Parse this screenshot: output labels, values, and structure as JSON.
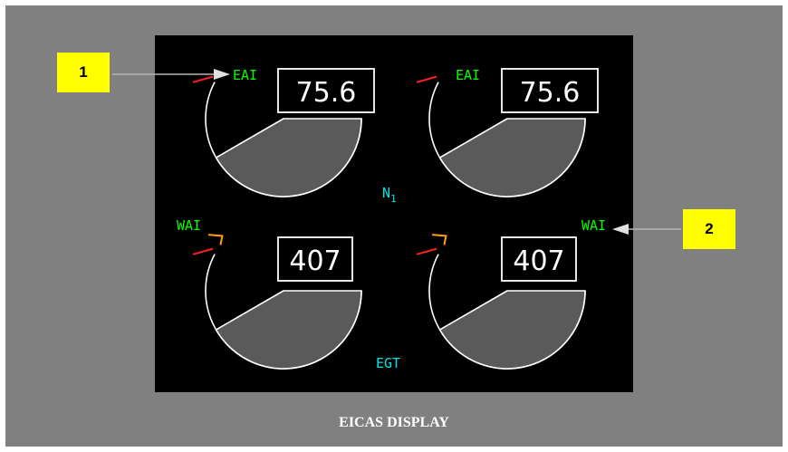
{
  "title": "EICAS DISPLAY",
  "n1_label": "N",
  "n1_subscript": "1",
  "egt_label": "EGT",
  "gauges": {
    "left_n1": {
      "value": "75.6",
      "flag": "EAI"
    },
    "right_n1": {
      "value": "75.6",
      "flag": "EAI"
    },
    "left_egt": {
      "value": "407",
      "flag": "WAI"
    },
    "right_egt": {
      "value": "407",
      "flag": ""
    }
  },
  "side_flag_right": "WAI",
  "callouts": {
    "one": "1",
    "two": "2"
  },
  "colors": {
    "background": "#808080",
    "screen": "#000000",
    "flag_green": "#00ff00",
    "label_cyan": "#00e6e6",
    "redline": "#ff2020",
    "amber": "#ffa000",
    "fill": "#5a5a5a",
    "callout_yellow": "#ffff00"
  }
}
